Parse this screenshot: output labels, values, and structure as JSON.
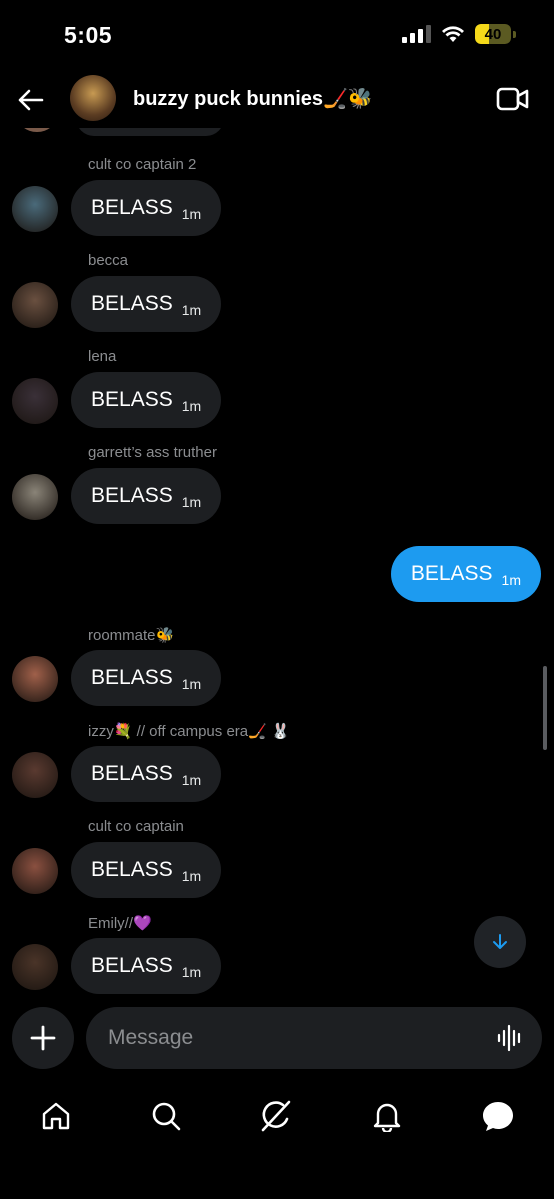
{
  "status": {
    "time": "5:05",
    "battery_level": "40",
    "battery_fraction": 0.4
  },
  "header": {
    "title": "buzzy puck bunnies🏒🐝"
  },
  "messages": [
    {
      "sender": "cult co captain 2",
      "text": "BELASS",
      "time": "1m",
      "avatar_color": "#4a6a7a"
    },
    {
      "sender": "becca",
      "text": "BELASS",
      "time": "1m",
      "avatar_color": "#6a5040"
    },
    {
      "sender": "lena",
      "text": "BELASS",
      "time": "1m",
      "avatar_color": "#3a3038"
    },
    {
      "sender": "garrett’s ass truther",
      "text": "BELASS",
      "time": "1m",
      "avatar_color": "#8a8478"
    },
    {
      "sender": "",
      "text": "BELASS",
      "time": "1m",
      "outgoing": true
    },
    {
      "sender": "roommate🐝",
      "text": "BELASS",
      "time": "1m",
      "avatar_color": "#a0604a"
    },
    {
      "sender": "izzy💐 // off campus era🏒 🐰",
      "text": "BELASS",
      "time": "1m",
      "avatar_color": "#5a3a30"
    },
    {
      "sender": "cult co captain",
      "text": "BELASS",
      "time": "1m",
      "avatar_color": "#8a5040"
    },
    {
      "sender": "Emily//💜",
      "text": "BELASS",
      "time": "1m",
      "avatar_color": "#4a3428"
    }
  ],
  "composer": {
    "placeholder": "Message"
  },
  "colors": {
    "accent": "#1d9bf0",
    "bubble_incoming": "#1d1f22",
    "background": "#000000"
  },
  "nav": [
    "home-icon",
    "search-icon",
    "grok-icon",
    "notifications-icon",
    "messages-icon"
  ]
}
